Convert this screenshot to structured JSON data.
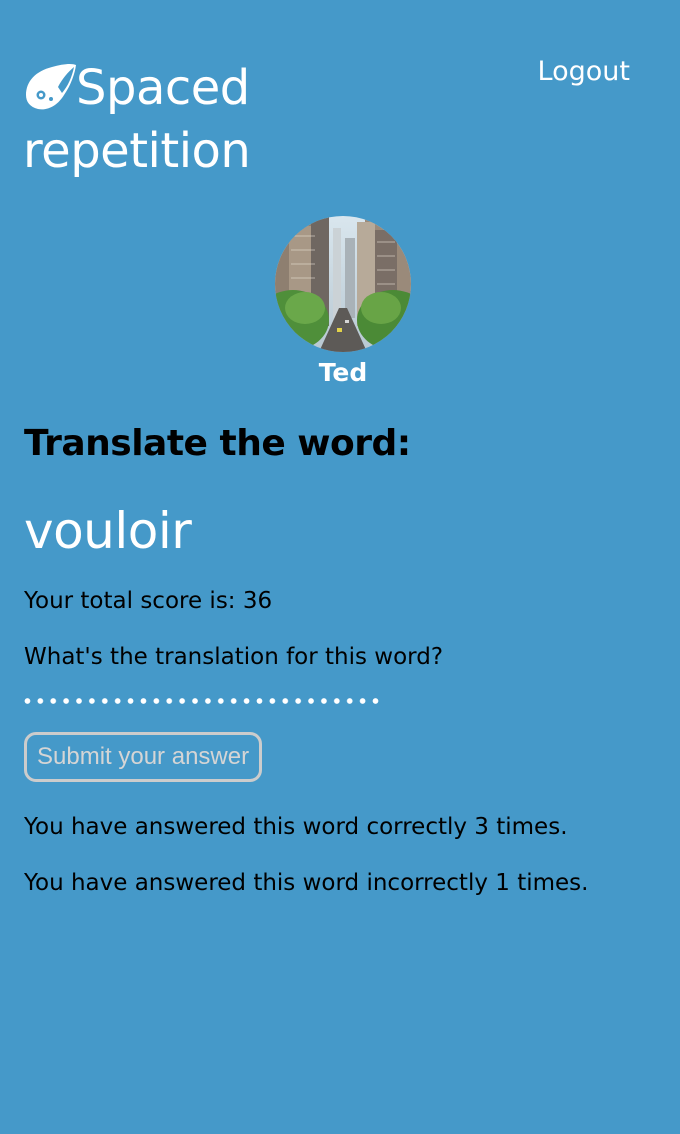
{
  "header": {
    "brand_line1": "Spaced",
    "brand_line2": "repetition",
    "logout_label": "Logout"
  },
  "user": {
    "name": "Ted",
    "avatar": "city-street-avatar"
  },
  "quiz": {
    "prompt_title": "Translate the word:",
    "word": "vouloir",
    "score_text": "Your total score is: 36",
    "question": "What's the translation for this word?",
    "answer_value": "",
    "submit_label": "Submit your answer",
    "correct_text": "You have answered this word correctly 3 times.",
    "incorrect_text": "You have answered this word incorrectly 1 times."
  },
  "colors": {
    "background": "#4599c9",
    "text_light": "#ffffff",
    "text_dark": "#000000",
    "button_border": "#cccccc"
  },
  "icons": {
    "logo": "alien-rocket-icon"
  }
}
